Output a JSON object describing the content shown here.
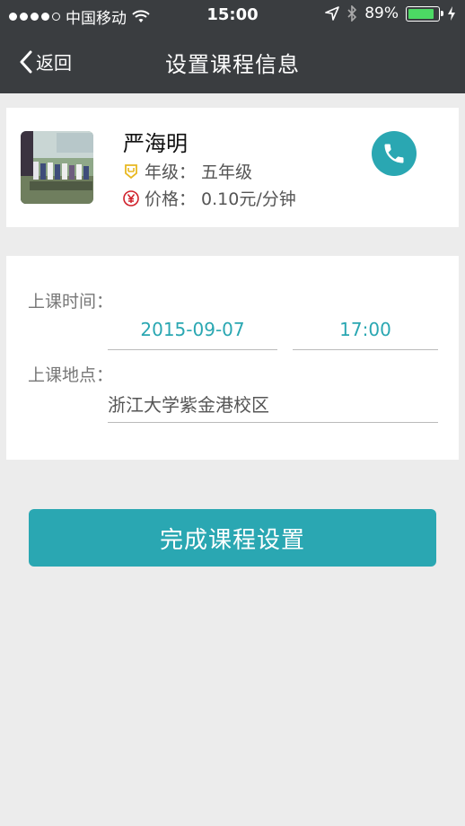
{
  "status_bar": {
    "carrier": "中国移动",
    "time": "15:00",
    "battery": "89%",
    "battery_level": 0.89
  },
  "header": {
    "back_label": "返回",
    "title": "设置课程信息"
  },
  "teacher": {
    "name": "严海明",
    "grade_label": "年级：",
    "grade_value": "五年级",
    "price_label": "价格：",
    "price_value": "0.10元/分钟"
  },
  "schedule": {
    "time_label": "上课时间：",
    "date_value": "2015-09-07",
    "hour_value": "17:00",
    "place_label": "上课地点：",
    "place_value": "浙江大学紫金港校区"
  },
  "actions": {
    "done_label": "完成课程设置"
  },
  "colors": {
    "accent": "#2aa7b2",
    "header_bg": "#3a3d40",
    "page_bg": "#ececec"
  }
}
